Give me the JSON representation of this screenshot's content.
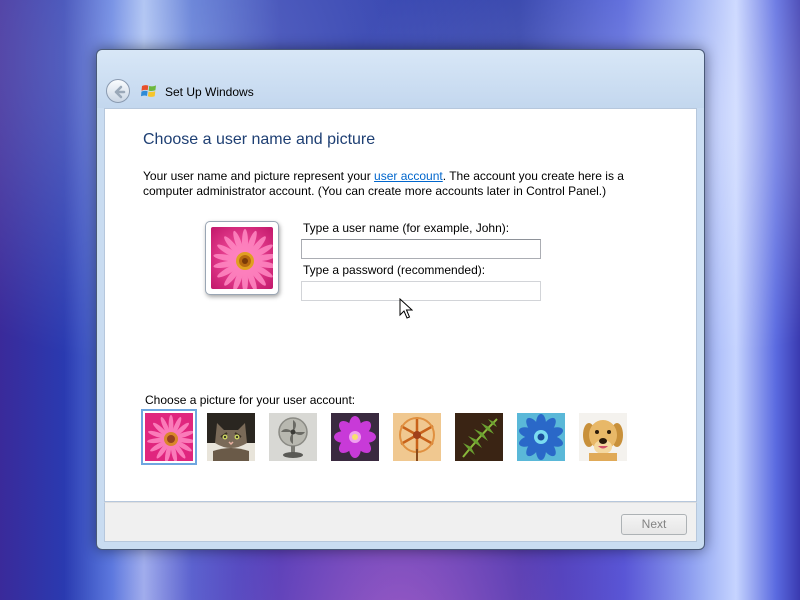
{
  "window": {
    "title": "Set Up Windows",
    "icon": "windows-logo-icon",
    "back_icon": "back-arrow-icon"
  },
  "page": {
    "heading": "Choose a user name and picture",
    "description_before": "Your user name and picture represent your ",
    "description_link": "user account",
    "description_after": ". The account you create here is a computer administrator account. (You can create more accounts later in Control Panel.)"
  },
  "form": {
    "username_label": "Type a user name (for example, John):",
    "username_value": "",
    "password_label": "Type a password (recommended):",
    "password_value": ""
  },
  "pictures": {
    "label": "Choose a picture for your user account:",
    "items": [
      {
        "name": "pink-daisy-picture",
        "selected": true
      },
      {
        "name": "kitten-picture",
        "selected": false
      },
      {
        "name": "fan-picture",
        "selected": false
      },
      {
        "name": "purple-flower-picture",
        "selected": false
      },
      {
        "name": "pinwheel-picture",
        "selected": false
      },
      {
        "name": "fern-picture",
        "selected": false
      },
      {
        "name": "blue-flower-picture",
        "selected": false
      },
      {
        "name": "golden-retriever-picture",
        "selected": false
      }
    ]
  },
  "footer": {
    "next_label": "Next",
    "next_enabled": false
  },
  "colors": {
    "heading": "#1e3f73",
    "link": "#0066cc",
    "selection": "#6fa6e0"
  }
}
